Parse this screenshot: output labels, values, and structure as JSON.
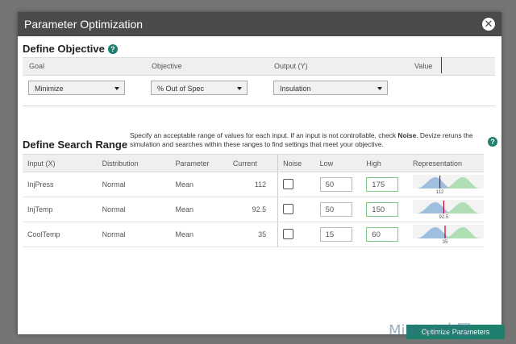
{
  "dialog": {
    "title": "Parameter Optimization"
  },
  "objective": {
    "heading": "Define Objective",
    "columns": {
      "goal": "Goal",
      "objective": "Objective",
      "output": "Output (Y)",
      "value": "Value"
    },
    "goal_value": "Minimize",
    "objective_value": "% Out of Spec",
    "output_value": "Insulation"
  },
  "search_range": {
    "heading": "Define Search Range",
    "description_a": "Specify an acceptable range of values for each input. If an input is not controllable, check ",
    "description_bold": "Noise",
    "description_b": ". Devize reruns the simulation and searches within these ranges to find settings that meet your objective.",
    "columns": {
      "input": "Input (X)",
      "distribution": "Distribution",
      "parameter": "Parameter",
      "current": "Current",
      "noise": "Noise",
      "low": "Low",
      "high": "High",
      "representation": "Representation"
    },
    "rows": [
      {
        "input": "InjPress",
        "distribution": "Normal",
        "parameter": "Mean",
        "current": "112",
        "noise": false,
        "low": "50",
        "high": "175",
        "rep_label": "112",
        "rep_pos": 0.37
      },
      {
        "input": "InjTemp",
        "distribution": "Normal",
        "parameter": "Mean",
        "current": "92.5",
        "noise": false,
        "low": "50",
        "high": "150",
        "rep_label": "92.5",
        "rep_pos": 0.43
      },
      {
        "input": "CoolTemp",
        "distribution": "Normal",
        "parameter": "Mean",
        "current": "35",
        "noise": false,
        "low": "15",
        "high": "60",
        "rep_label": "35",
        "rep_pos": 0.45
      }
    ]
  },
  "footer": {
    "optimize_label": "Optimize Parameters",
    "watermark": "Minitab中国"
  },
  "colors": {
    "accent": "#1e7f6e",
    "titlebar": "#4a4a4a",
    "blue_curve": "#9fbfdf",
    "green_curve": "#a8dcae",
    "marker": "#c0002a"
  }
}
